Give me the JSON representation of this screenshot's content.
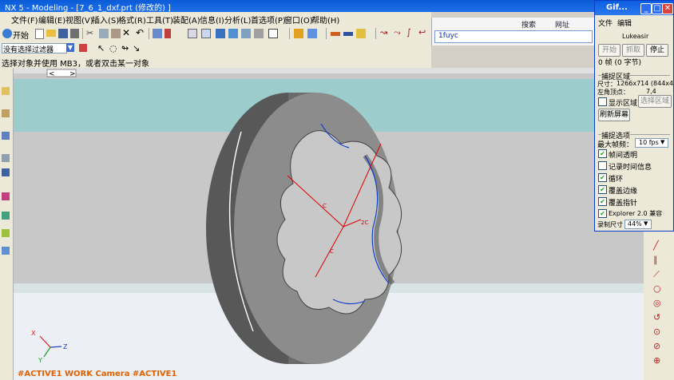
{
  "window": {
    "title": "NX 5 - Modeling - [7_6_1_dxf.prt  (修改的) ]"
  },
  "menubar": {
    "items": [
      "文件(F)",
      "编辑(E)",
      "视图(V)",
      "插入(S)",
      "格式(R)",
      "工具(T)",
      "装配(A)",
      "信息(I)",
      "分析(L)",
      "首选项(P)",
      "窗口(O)",
      "帮助(H)"
    ]
  },
  "toolbar": {
    "start_label": "开始",
    "filter_value": "没有选择过滤器"
  },
  "cue": {
    "text": "选择对象并使用 MB3，或者双击某一对象"
  },
  "browser": {
    "address": "1fuyc",
    "search_label": "搜索",
    "web_label": "网址"
  },
  "colors": {
    "viewport_bg": "#c8c8c8",
    "band": "#9ccccc",
    "wheel_face": "#8c8c8c",
    "wheel_side": "#5a5a5a",
    "hole": "#c8c8c8",
    "red": "#e00000",
    "blue": "#1040c8"
  },
  "model": {
    "label1": "C",
    "label2": "C",
    "label3": "2C"
  },
  "triad": {
    "x": "X",
    "y": "Y",
    "z": "Z"
  },
  "status": {
    "text": "#ACTIVE1 WORK Camera #ACTIVE1"
  },
  "gif_panel": {
    "title": "Gif...",
    "menu": [
      "文件",
      "编辑"
    ],
    "id_text": "Lukeasir",
    "buttons": {
      "start": "开始",
      "capture": "抓取",
      "stop": "停止"
    },
    "frame_info": "0 帧 (0 字节)",
    "capture_group": "捕捉区域",
    "size_label": "尺寸：",
    "size_value": "1266x714 (844x476)",
    "corner_label": "左角顶点：",
    "corner_value": "7,4",
    "show_region": "显示区域",
    "select_region": "选择区域",
    "refresh": "刷新屏幕",
    "options_group": "捕捉选项",
    "max_fps_label": "最大帧频：",
    "max_fps_value": "10 fps",
    "options": [
      {
        "label": "帧间透明",
        "checked": true
      },
      {
        "label": "记录时间信息",
        "checked": false
      },
      {
        "label": "循环",
        "checked": true
      },
      {
        "label": "覆盖边缘",
        "checked": true
      },
      {
        "label": "覆盖指针",
        "checked": true
      },
      {
        "label": "Explorer 2.0 兼容",
        "checked": true
      }
    ],
    "record_size_label": "录制尺寸",
    "record_size_value": "44%"
  }
}
